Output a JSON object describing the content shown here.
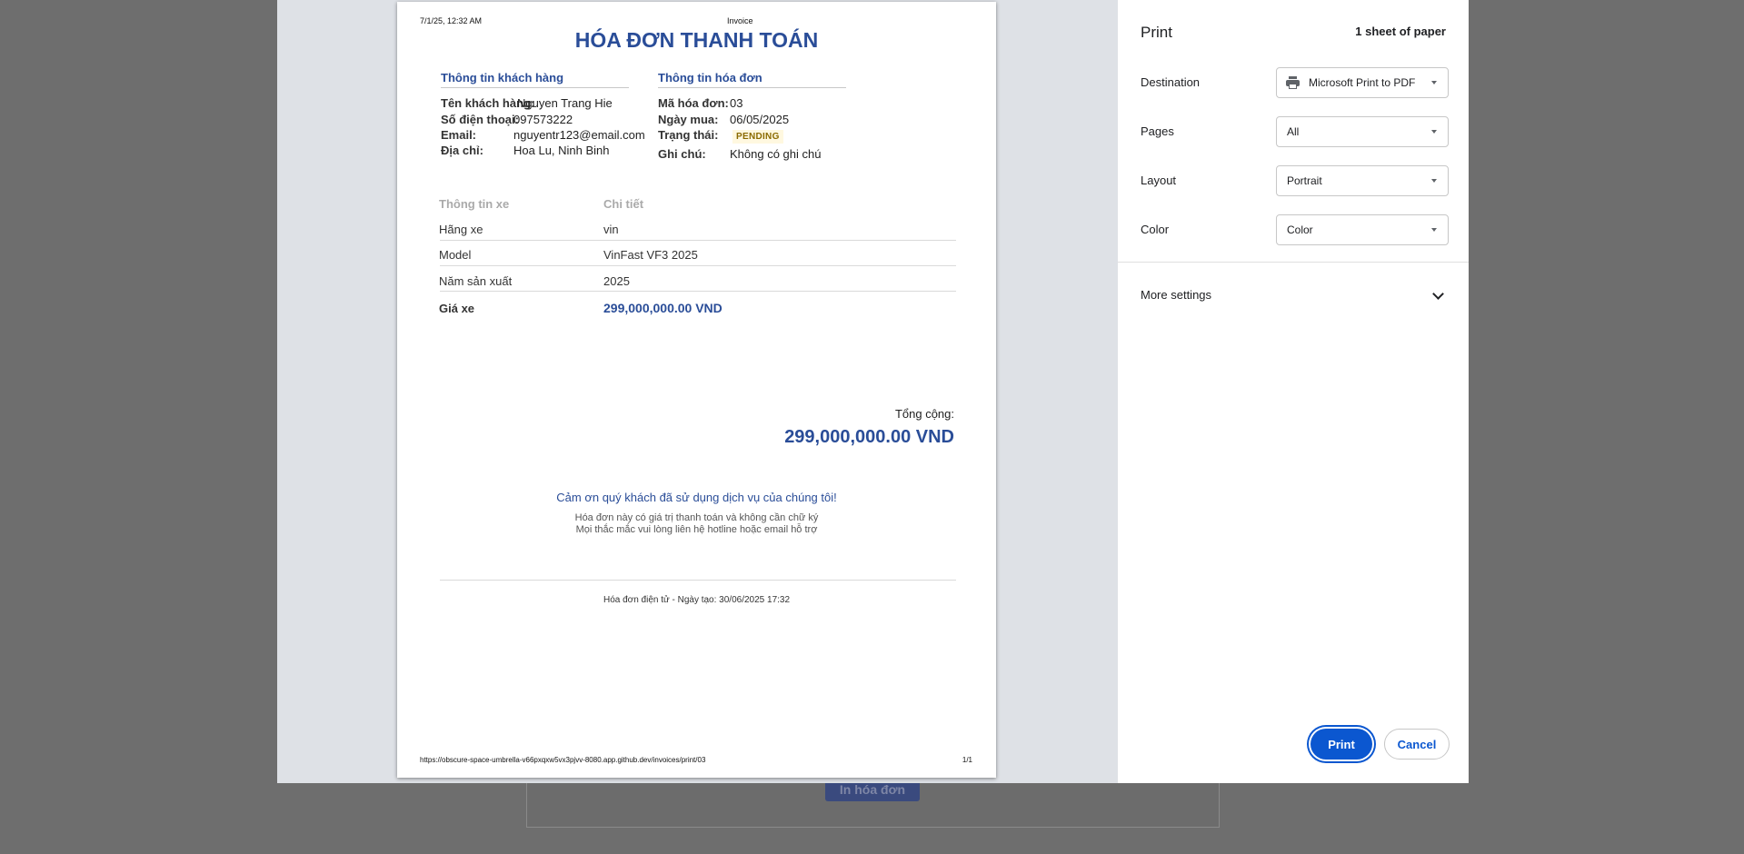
{
  "background": {
    "print_button_label": "In hóa đơn"
  },
  "preview": {
    "header_date": "7/1/25, 12:32 AM",
    "header_title": "Invoice",
    "invoice_title": "HÓA ĐƠN THANH TOÁN",
    "customer": {
      "section_title": "Thông tin khách hàng",
      "name_label": "Tên khách hàng:",
      "name_value": "Nguyen Trang Hie",
      "phone_label": "Số điện thoại:",
      "phone_value": "097573222",
      "email_label": "Email:",
      "email_value": "nguyentr123@email.com",
      "address_label": "Địa chỉ:",
      "address_value": "Hoa Lu, Ninh Binh"
    },
    "invoice": {
      "section_title": "Thông tin hóa đơn",
      "id_label": "Mã hóa đơn:",
      "id_value": "03",
      "date_label": "Ngày mua:",
      "date_value": "06/05/2025",
      "status_label": "Trạng thái:",
      "status_value": "PENDING",
      "note_label": "Ghi chú:",
      "note_value": "Không có ghi chú"
    },
    "table": {
      "col1": "Thông tin xe",
      "col2": "Chi tiết",
      "rows": [
        {
          "label": "Hãng xe",
          "value": "vin"
        },
        {
          "label": "Model",
          "value": "VinFast VF3 2025"
        },
        {
          "label": "Năm sản xuất",
          "value": "2025"
        }
      ],
      "price_label": "Giá xe",
      "price_value": "299,000,000.00 VND"
    },
    "total_label": "Tổng cộng:",
    "total_value": "299,000,000.00 VND",
    "thanks": "Cảm ơn quý khách đã sử dụng dịch vụ của chúng tôi!",
    "note1": "Hóa đơn này có giá trị thanh toán và không cần chữ ký",
    "note2": "Mọi thắc mắc vui lòng liên hệ hotline hoặc email hỗ trợ",
    "footer": "Hóa đơn điện tử - Ngày tạo: 30/06/2025 17:32",
    "url": "https://obscure-space-umbrella-v66pxqxw5vx3pjvv-8080.app.github.dev/invoices/print/03",
    "page_number": "1/1"
  },
  "settings": {
    "title": "Print",
    "sheets": "1 sheet of paper",
    "destination_label": "Destination",
    "destination_value": "Microsoft Print to PDF",
    "destination_icon": "printer-icon",
    "pages_label": "Pages",
    "pages_value": "All",
    "layout_label": "Layout",
    "layout_value": "Portrait",
    "color_label": "Color",
    "color_value": "Color",
    "more_settings": "More settings",
    "print_button": "Print",
    "cancel_button": "Cancel",
    "accent_color": "#0b57d0",
    "invoice_blue": "#2a4d98"
  }
}
